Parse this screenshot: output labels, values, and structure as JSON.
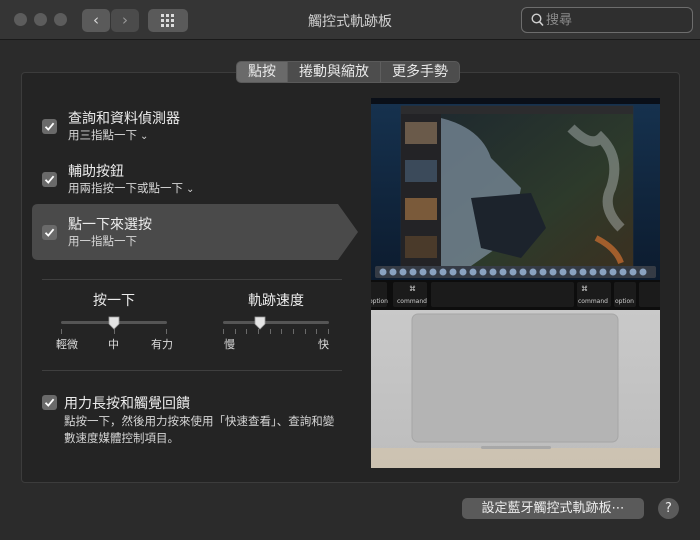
{
  "window": {
    "title": "觸控式軌跡板",
    "back_icon": "‹",
    "forward_icon": "›"
  },
  "search": {
    "placeholder": "搜尋"
  },
  "tabs": [
    {
      "label": "點按",
      "active": true
    },
    {
      "label": "捲動與縮放",
      "active": false
    },
    {
      "label": "更多手勢",
      "active": false
    }
  ],
  "options": [
    {
      "title": "查詢和資料偵測器",
      "subtitle": "用三指點一下",
      "checked": true
    },
    {
      "title": "輔助按鈕",
      "subtitle": "用兩指按一下或點一下",
      "checked": true
    },
    {
      "title": "點一下來選按",
      "subtitle": "用一指點一下",
      "checked": true,
      "selected": true
    }
  ],
  "click_slider": {
    "label": "按一下",
    "ticks": [
      "輕微",
      "中",
      "有力"
    ],
    "value_index": 1
  },
  "speed_slider": {
    "label": "軌跡速度",
    "min_label": "慢",
    "max_label": "快",
    "value_index": 2,
    "tick_count": 10
  },
  "force_click": {
    "title": "用力長按和觸覺回饋",
    "checked": true,
    "description": "點按一下，然後用力按來使用「快速查看」、查詢和變數速度媒體控制項目。"
  },
  "preview": {
    "touchbar_keys": [
      "option",
      "command",
      "command",
      "option"
    ],
    "touchbar_cmd_symbol": "⌘"
  },
  "footer": {
    "bluetooth_button": "設定藍牙觸控式軌跡板⋯",
    "help": "?"
  },
  "colors": {
    "window_bg": "#2b2b2b",
    "panel_bg": "#242424",
    "selection_bg": "#4a4a4a",
    "control_bg": "#5a5a5a"
  }
}
